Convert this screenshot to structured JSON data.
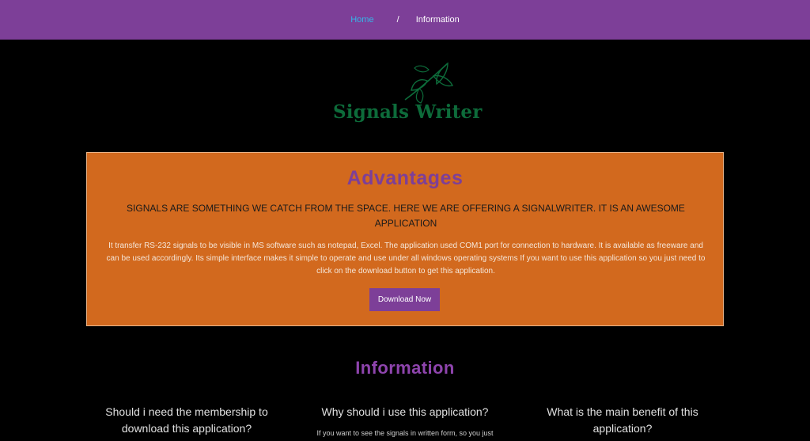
{
  "breadcrumb": {
    "home": "Home",
    "separator": "/",
    "current": "Information"
  },
  "logo": {
    "text": "Signals Writer",
    "icon": "leaf-icon"
  },
  "advantages": {
    "title": "Advantages",
    "subtitle": "SIGNALS ARE SOMETHING WE CATCH FROM THE SPACE. HERE WE ARE OFFERING A SIGNALWRITER. IT IS AN AWESOME APPLICATION",
    "body": "It transfer RS-232 signals to be visible in MS software such as notepad, Excel. The application used COM1 port for connection to hardware. It is available as freeware and can be used accordingly. Its simple interface makes it simple to operate and use under all windows operating systems If you want to use this application so you just need to click on the download button to get this application.",
    "button": "Download Now"
  },
  "information": {
    "title": "Information",
    "faqs": [
      {
        "question": "Should i need the membership to download this application?",
        "answer": ""
      },
      {
        "question": "Why should i use this application?",
        "answer": "If you want to see the signals in written form, so you just"
      },
      {
        "question": "What is the main benefit of this application?",
        "answer": ""
      }
    ]
  },
  "colors": {
    "header": "#7d3f98",
    "accent": "#7d3f98",
    "box": "#d2691e",
    "logo": "#0d6b3a",
    "link": "#35b6e8",
    "background": "#000000"
  }
}
